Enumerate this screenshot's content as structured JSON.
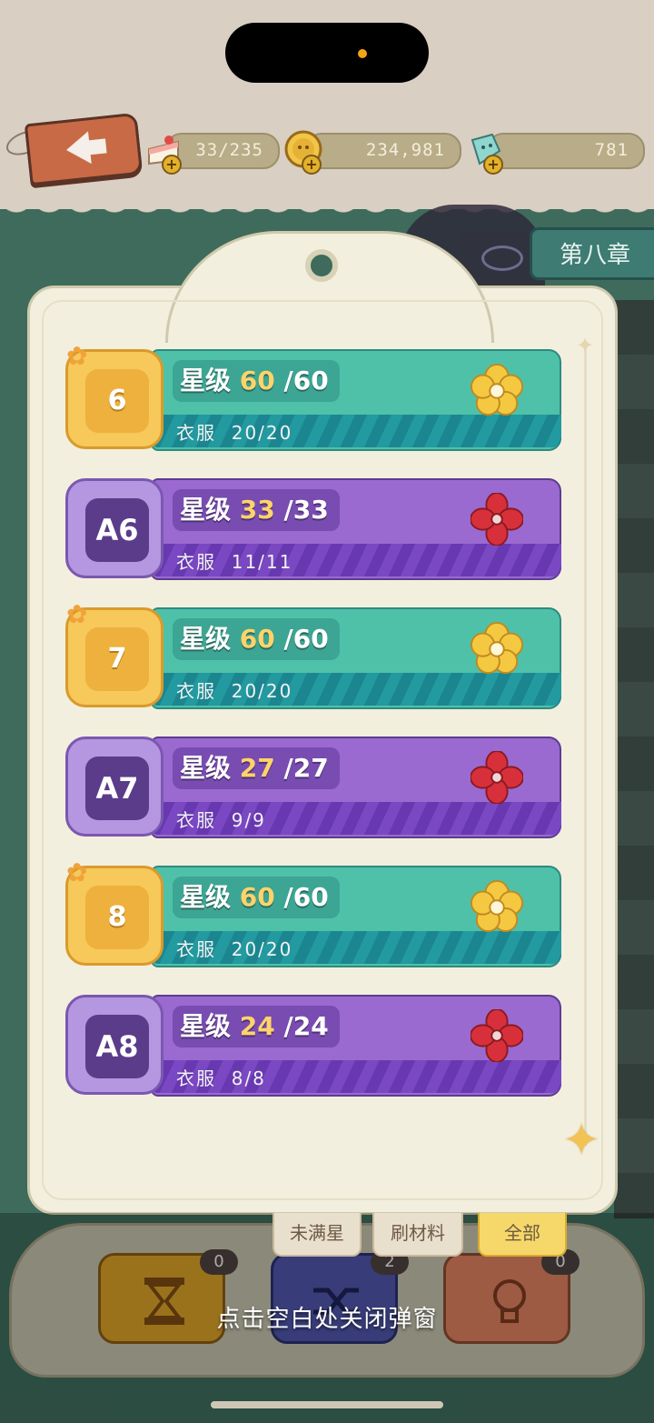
{
  "header": {
    "cake": "33/235",
    "coins": "234,981",
    "gems": "781"
  },
  "chapter_tab": "第八章",
  "rows": [
    {
      "badge": "6",
      "star_label": "星级",
      "star_current": "60",
      "star_total": "/60",
      "clothes_label": "衣服",
      "clothes_value": "20/20",
      "type": "gold"
    },
    {
      "badge": "A6",
      "star_label": "星级",
      "star_current": "33",
      "star_total": "/33",
      "clothes_label": "衣服",
      "clothes_value": "11/11",
      "type": "purple"
    },
    {
      "badge": "7",
      "star_label": "星级",
      "star_current": "60",
      "star_total": "/60",
      "clothes_label": "衣服",
      "clothes_value": "20/20",
      "type": "gold"
    },
    {
      "badge": "A7",
      "star_label": "星级",
      "star_current": "27",
      "star_total": "/27",
      "clothes_label": "衣服",
      "clothes_value": "9/9",
      "type": "purple"
    },
    {
      "badge": "8",
      "star_label": "星级",
      "star_current": "60",
      "star_total": "/60",
      "clothes_label": "衣服",
      "clothes_value": "20/20",
      "type": "gold"
    },
    {
      "badge": "A8",
      "star_label": "星级",
      "star_current": "24",
      "star_total": "/24",
      "clothes_label": "衣服",
      "clothes_value": "8/8",
      "type": "purple"
    }
  ],
  "tabs": {
    "not_full": "未满星",
    "materials": "刷材料",
    "all": "全部"
  },
  "tools": {
    "hourglass_count": "0",
    "shuffle_count": "2",
    "bulb_count": "0"
  },
  "close_hint": "点击空白处关闭弹窗",
  "colors": {
    "teal_ribbon": "#4fc1a9",
    "purple_ribbon": "#9a6ad0",
    "gold_badge": "#f7c85a",
    "star_highlight": "#ffd36a"
  }
}
